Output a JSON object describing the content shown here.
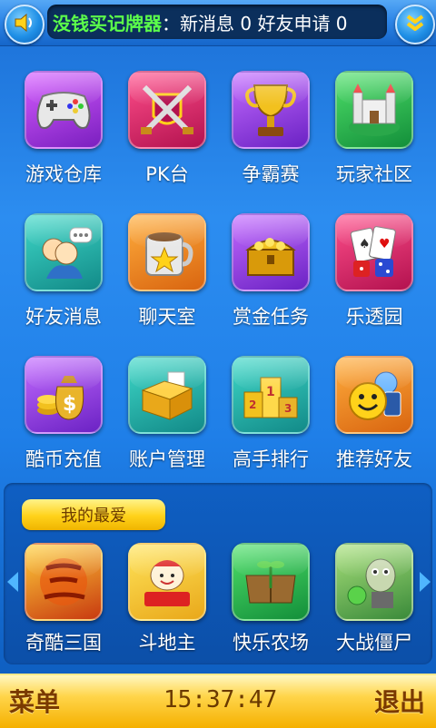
{
  "header": {
    "sound_icon": "speaker-icon",
    "marquee_name": "没钱买记牌器",
    "marquee_text": "：新消息 0 好友申请 0",
    "expand_icon": "double-chevron-down-icon"
  },
  "grid": [
    {
      "label": "游戏仓库",
      "icon": "gamepad-icon"
    },
    {
      "label": "PK台",
      "icon": "crossed-swords-icon"
    },
    {
      "label": "争霸赛",
      "icon": "trophy-icon"
    },
    {
      "label": "玩家社区",
      "icon": "castle-icon"
    },
    {
      "label": "好友消息",
      "icon": "friends-chat-icon"
    },
    {
      "label": "聊天室",
      "icon": "coffee-cup-icon"
    },
    {
      "label": "赏金任务",
      "icon": "treasure-chest-icon"
    },
    {
      "label": "乐透园",
      "icon": "cards-dice-icon"
    },
    {
      "label": "酷币充值",
      "icon": "money-bag-icon"
    },
    {
      "label": "账户管理",
      "icon": "file-box-icon"
    },
    {
      "label": "高手排行",
      "icon": "podium-icon"
    },
    {
      "label": "推荐好友",
      "icon": "smiley-recommend-icon"
    }
  ],
  "favorites": {
    "title": "我的最爱",
    "items": [
      {
        "label": "奇酷三国",
        "icon": "three-kingdoms-icon"
      },
      {
        "label": "斗地主",
        "icon": "doudizhu-icon"
      },
      {
        "label": "快乐农场",
        "icon": "farm-sprout-icon"
      },
      {
        "label": "大战僵尸",
        "icon": "zombie-icon"
      }
    ]
  },
  "footer": {
    "menu_label": "菜单",
    "time": "15:37:47",
    "exit_label": "退出"
  },
  "colors": {
    "accent_green": "#5cff4a",
    "bar_yellow": "#ffd54a",
    "background_blue": "#2c8df0"
  }
}
